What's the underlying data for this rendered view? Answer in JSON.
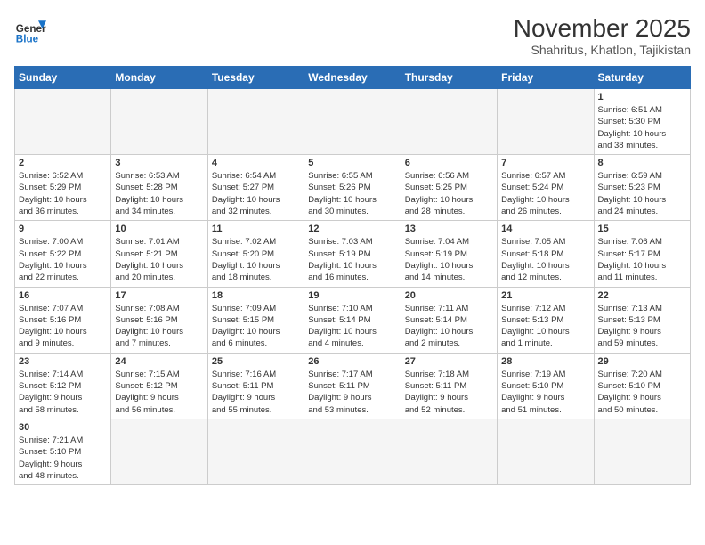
{
  "header": {
    "logo_line1": "General",
    "logo_line2": "Blue",
    "month": "November 2025",
    "location": "Shahritus, Khatlon, Tajikistan"
  },
  "weekdays": [
    "Sunday",
    "Monday",
    "Tuesday",
    "Wednesday",
    "Thursday",
    "Friday",
    "Saturday"
  ],
  "days": [
    {
      "num": "",
      "info": ""
    },
    {
      "num": "",
      "info": ""
    },
    {
      "num": "",
      "info": ""
    },
    {
      "num": "",
      "info": ""
    },
    {
      "num": "",
      "info": ""
    },
    {
      "num": "",
      "info": ""
    },
    {
      "num": "1",
      "info": "Sunrise: 6:51 AM\nSunset: 5:30 PM\nDaylight: 10 hours\nand 38 minutes."
    },
    {
      "num": "2",
      "info": "Sunrise: 6:52 AM\nSunset: 5:29 PM\nDaylight: 10 hours\nand 36 minutes."
    },
    {
      "num": "3",
      "info": "Sunrise: 6:53 AM\nSunset: 5:28 PM\nDaylight: 10 hours\nand 34 minutes."
    },
    {
      "num": "4",
      "info": "Sunrise: 6:54 AM\nSunset: 5:27 PM\nDaylight: 10 hours\nand 32 minutes."
    },
    {
      "num": "5",
      "info": "Sunrise: 6:55 AM\nSunset: 5:26 PM\nDaylight: 10 hours\nand 30 minutes."
    },
    {
      "num": "6",
      "info": "Sunrise: 6:56 AM\nSunset: 5:25 PM\nDaylight: 10 hours\nand 28 minutes."
    },
    {
      "num": "7",
      "info": "Sunrise: 6:57 AM\nSunset: 5:24 PM\nDaylight: 10 hours\nand 26 minutes."
    },
    {
      "num": "8",
      "info": "Sunrise: 6:59 AM\nSunset: 5:23 PM\nDaylight: 10 hours\nand 24 minutes."
    },
    {
      "num": "9",
      "info": "Sunrise: 7:00 AM\nSunset: 5:22 PM\nDaylight: 10 hours\nand 22 minutes."
    },
    {
      "num": "10",
      "info": "Sunrise: 7:01 AM\nSunset: 5:21 PM\nDaylight: 10 hours\nand 20 minutes."
    },
    {
      "num": "11",
      "info": "Sunrise: 7:02 AM\nSunset: 5:20 PM\nDaylight: 10 hours\nand 18 minutes."
    },
    {
      "num": "12",
      "info": "Sunrise: 7:03 AM\nSunset: 5:19 PM\nDaylight: 10 hours\nand 16 minutes."
    },
    {
      "num": "13",
      "info": "Sunrise: 7:04 AM\nSunset: 5:19 PM\nDaylight: 10 hours\nand 14 minutes."
    },
    {
      "num": "14",
      "info": "Sunrise: 7:05 AM\nSunset: 5:18 PM\nDaylight: 10 hours\nand 12 minutes."
    },
    {
      "num": "15",
      "info": "Sunrise: 7:06 AM\nSunset: 5:17 PM\nDaylight: 10 hours\nand 11 minutes."
    },
    {
      "num": "16",
      "info": "Sunrise: 7:07 AM\nSunset: 5:16 PM\nDaylight: 10 hours\nand 9 minutes."
    },
    {
      "num": "17",
      "info": "Sunrise: 7:08 AM\nSunset: 5:16 PM\nDaylight: 10 hours\nand 7 minutes."
    },
    {
      "num": "18",
      "info": "Sunrise: 7:09 AM\nSunset: 5:15 PM\nDaylight: 10 hours\nand 6 minutes."
    },
    {
      "num": "19",
      "info": "Sunrise: 7:10 AM\nSunset: 5:14 PM\nDaylight: 10 hours\nand 4 minutes."
    },
    {
      "num": "20",
      "info": "Sunrise: 7:11 AM\nSunset: 5:14 PM\nDaylight: 10 hours\nand 2 minutes."
    },
    {
      "num": "21",
      "info": "Sunrise: 7:12 AM\nSunset: 5:13 PM\nDaylight: 10 hours\nand 1 minute."
    },
    {
      "num": "22",
      "info": "Sunrise: 7:13 AM\nSunset: 5:13 PM\nDaylight: 9 hours\nand 59 minutes."
    },
    {
      "num": "23",
      "info": "Sunrise: 7:14 AM\nSunset: 5:12 PM\nDaylight: 9 hours\nand 58 minutes."
    },
    {
      "num": "24",
      "info": "Sunrise: 7:15 AM\nSunset: 5:12 PM\nDaylight: 9 hours\nand 56 minutes."
    },
    {
      "num": "25",
      "info": "Sunrise: 7:16 AM\nSunset: 5:11 PM\nDaylight: 9 hours\nand 55 minutes."
    },
    {
      "num": "26",
      "info": "Sunrise: 7:17 AM\nSunset: 5:11 PM\nDaylight: 9 hours\nand 53 minutes."
    },
    {
      "num": "27",
      "info": "Sunrise: 7:18 AM\nSunset: 5:11 PM\nDaylight: 9 hours\nand 52 minutes."
    },
    {
      "num": "28",
      "info": "Sunrise: 7:19 AM\nSunset: 5:10 PM\nDaylight: 9 hours\nand 51 minutes."
    },
    {
      "num": "29",
      "info": "Sunrise: 7:20 AM\nSunset: 5:10 PM\nDaylight: 9 hours\nand 50 minutes."
    },
    {
      "num": "30",
      "info": "Sunrise: 7:21 AM\nSunset: 5:10 PM\nDaylight: 9 hours\nand 48 minutes."
    },
    {
      "num": "",
      "info": ""
    },
    {
      "num": "",
      "info": ""
    },
    {
      "num": "",
      "info": ""
    },
    {
      "num": "",
      "info": ""
    },
    {
      "num": "",
      "info": ""
    },
    {
      "num": "",
      "info": ""
    }
  ]
}
